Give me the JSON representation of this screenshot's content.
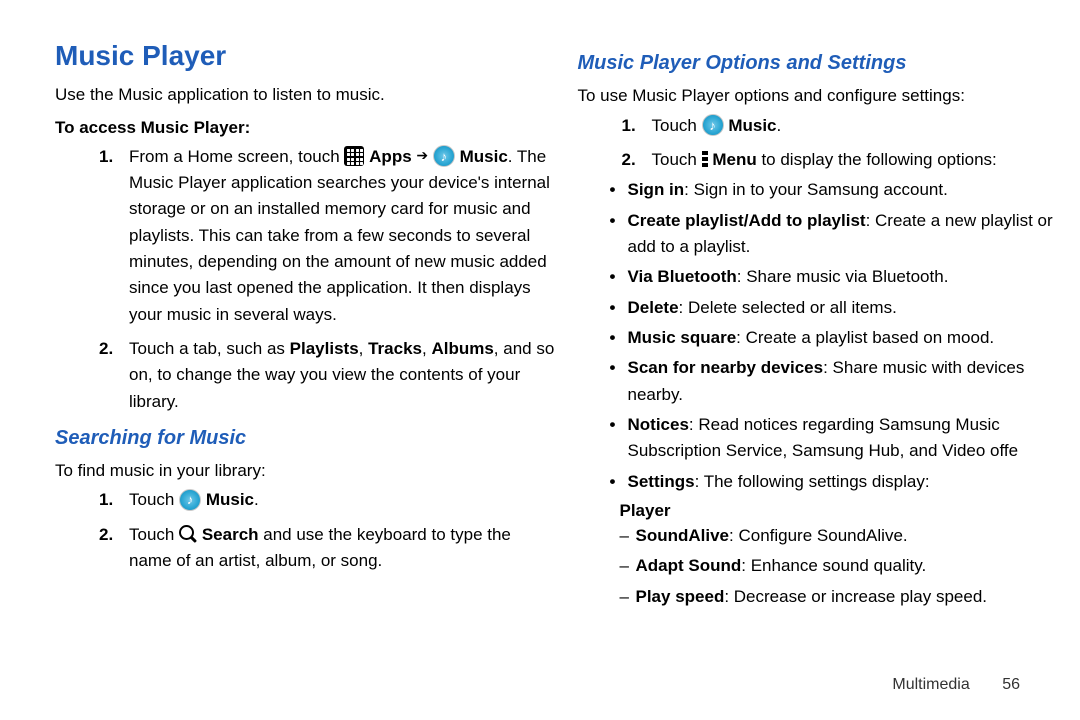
{
  "left": {
    "h1": "Music Player",
    "intro": "Use the Music application to listen to music.",
    "h3_access": "To access Music Player:",
    "item1_a": "From a Home screen, touch ",
    "apps_label": "Apps",
    "item1_b": " ",
    "music_label": "Music",
    "item1_c": ". The Music Player application searches your device's internal storage or on an installed memory card for music and playlists. This can take from a few seconds to several minutes, depending on the amount of new music added since you last opened the application. It then displays your music in several ways.",
    "item2_a": "Touch a tab, such as ",
    "playlists": "Playlists",
    "tracks": "Tracks",
    "albums": "Albums",
    "item2_b": ", and so on, to change the way you view the contents of your library.",
    "h2_search": "Searching for Music",
    "search_intro": "To find music in your library:",
    "s1_a": "Touch ",
    "s1_b": ".",
    "s2_a": "Touch ",
    "search_label": "Search",
    "s2_b": " and use the keyboard to type the name of an artist, album, or song.",
    "comma": ", "
  },
  "right": {
    "h2_options": "Music Player Options and Settings",
    "intro": "To use Music Player options and configure settings:",
    "r1_a": "Touch ",
    "music_label": "Music",
    "r1_b": ".",
    "r2_a": "Touch ",
    "menu_label": "Menu",
    "r2_b": " to display the following options:",
    "bullets": [
      {
        "b": "Sign in",
        "t": ": Sign in to your Samsung account."
      },
      {
        "b": "Create playlist/Add to playlist",
        "t": ": Create a new playlist or add to a playlist."
      },
      {
        "b": "Via Bluetooth",
        "t": ": Share music via Bluetooth."
      },
      {
        "b": "Delete",
        "t": ": Delete selected or all items."
      },
      {
        "b": "Music square",
        "t": ": Create a playlist based on mood."
      },
      {
        "b": "Scan for nearby devices",
        "t": ": Share music with devices nearby."
      },
      {
        "b": "Notices",
        "t": ": Read notices regarding Samsung Music Subscription Service, Samsung Hub, and Video offe"
      },
      {
        "b": "Settings",
        "t": ": The following settings display:"
      }
    ],
    "player_h": "Player",
    "dashes": [
      {
        "b": "SoundAlive",
        "t": ": Configure SoundAlive."
      },
      {
        "b": "Adapt Sound",
        "t": ": Enhance sound quality."
      },
      {
        "b": "Play speed",
        "t": ": Decrease or increase play speed."
      }
    ]
  },
  "footer": {
    "section": "Multimedia",
    "page": "56"
  },
  "nums": {
    "one": "1.",
    "two": "2."
  }
}
